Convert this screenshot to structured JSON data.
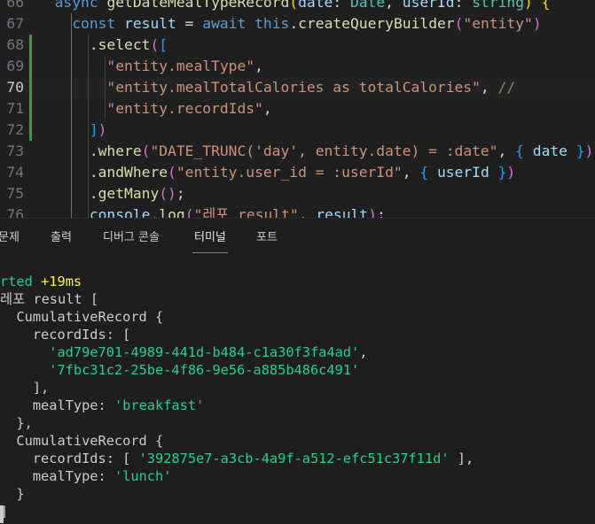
{
  "editor": {
    "lines": [
      {
        "num": "66",
        "tokens": [
          {
            "t": "  ",
            "c": "pn"
          },
          {
            "t": "async ",
            "c": "kw"
          },
          {
            "t": "getDateMealTypeRecord",
            "c": "fn"
          },
          {
            "t": "(",
            "c": "br1"
          },
          {
            "t": "date",
            "c": "param"
          },
          {
            "t": ": ",
            "c": "pn"
          },
          {
            "t": "Date",
            "c": "ty"
          },
          {
            "t": ", ",
            "c": "pn"
          },
          {
            "t": "userId",
            "c": "param"
          },
          {
            "t": ": ",
            "c": "pn"
          },
          {
            "t": "string",
            "c": "ty"
          },
          {
            "t": ") ",
            "c": "br1"
          },
          {
            "t": "{",
            "c": "br1"
          }
        ]
      },
      {
        "num": "67",
        "tokens": [
          {
            "t": "    ",
            "c": "pn"
          },
          {
            "t": "const ",
            "c": "kw"
          },
          {
            "t": "result",
            "c": "param"
          },
          {
            "t": " = ",
            "c": "pn"
          },
          {
            "t": "await ",
            "c": "kw"
          },
          {
            "t": "this",
            "c": "kw"
          },
          {
            "t": ".",
            "c": "pn"
          },
          {
            "t": "createQueryBuilder",
            "c": "fn"
          },
          {
            "t": "(",
            "c": "br2"
          },
          {
            "t": "\"entity\"",
            "c": "str"
          },
          {
            "t": ")",
            "c": "br2"
          }
        ]
      },
      {
        "num": "68",
        "tokens": [
          {
            "t": "      .",
            "c": "pn"
          },
          {
            "t": "select",
            "c": "fn"
          },
          {
            "t": "(",
            "c": "br2"
          },
          {
            "t": "[",
            "c": "br3"
          }
        ]
      },
      {
        "num": "69",
        "tokens": [
          {
            "t": "        ",
            "c": "pn"
          },
          {
            "t": "\"entity.mealType\"",
            "c": "str"
          },
          {
            "t": ",",
            "c": "pn"
          }
        ]
      },
      {
        "num": "70",
        "tokens": [
          {
            "t": "        ",
            "c": "pn"
          },
          {
            "t": "\"entity.mealTotalCalories as totalCalories\"",
            "c": "str"
          },
          {
            "t": ", ",
            "c": "pn"
          },
          {
            "t": "//",
            "c": "cm"
          }
        ]
      },
      {
        "num": "71",
        "tokens": [
          {
            "t": "        ",
            "c": "pn"
          },
          {
            "t": "\"entity.recordIds\"",
            "c": "str"
          },
          {
            "t": ",",
            "c": "pn"
          }
        ]
      },
      {
        "num": "72",
        "tokens": [
          {
            "t": "      ",
            "c": "pn"
          },
          {
            "t": "]",
            "c": "br3"
          },
          {
            "t": ")",
            "c": "br2"
          }
        ]
      },
      {
        "num": "73",
        "tokens": [
          {
            "t": "      .",
            "c": "pn"
          },
          {
            "t": "where",
            "c": "fn"
          },
          {
            "t": "(",
            "c": "br2"
          },
          {
            "t": "\"DATE_TRUNC('day', entity.date) = :date\"",
            "c": "str"
          },
          {
            "t": ", ",
            "c": "pn"
          },
          {
            "t": "{",
            "c": "br3"
          },
          {
            "t": " date ",
            "c": "param"
          },
          {
            "t": "}",
            "c": "br3"
          },
          {
            "t": ")",
            "c": "br2"
          }
        ]
      },
      {
        "num": "74",
        "tokens": [
          {
            "t": "      .",
            "c": "pn"
          },
          {
            "t": "andWhere",
            "c": "fn"
          },
          {
            "t": "(",
            "c": "br2"
          },
          {
            "t": "\"entity.user_id = :userId\"",
            "c": "str"
          },
          {
            "t": ", ",
            "c": "pn"
          },
          {
            "t": "{",
            "c": "br3"
          },
          {
            "t": " userId ",
            "c": "param"
          },
          {
            "t": "}",
            "c": "br3"
          },
          {
            "t": ")",
            "c": "br2"
          }
        ]
      },
      {
        "num": "75",
        "tokens": [
          {
            "t": "      .",
            "c": "pn"
          },
          {
            "t": "getMany",
            "c": "fn"
          },
          {
            "t": "()",
            "c": "br2"
          },
          {
            "t": ";",
            "c": "pn"
          }
        ]
      },
      {
        "num": "76",
        "tokens": [
          {
            "t": "      ",
            "c": "pn"
          },
          {
            "t": "console",
            "c": "param"
          },
          {
            "t": ".",
            "c": "pn"
          },
          {
            "t": "log",
            "c": "fn"
          },
          {
            "t": "(",
            "c": "br2"
          },
          {
            "t": "\"레포 result\"",
            "c": "str"
          },
          {
            "t": ", ",
            "c": "pn"
          },
          {
            "t": "result",
            "c": "param"
          },
          {
            "t": ")",
            "c": "br2"
          },
          {
            "t": ";",
            "c": "pn"
          }
        ]
      }
    ],
    "current_line": "70"
  },
  "panel": {
    "tabs": [
      "문제",
      "출력",
      "디버그 콘솔",
      "터미널",
      "포트"
    ],
    "active_tab": "터미널"
  },
  "terminal": {
    "lines": [
      [
        {
          "t": "rted ",
          "c": "tgreen"
        },
        {
          "t": "+19ms",
          "c": "tyellow"
        }
      ],
      [
        {
          "t": "레포 result [",
          "c": ""
        }
      ],
      [
        {
          "t": "  CumulativeRecord {",
          "c": ""
        }
      ],
      [
        {
          "t": "    recordIds: [",
          "c": ""
        }
      ],
      [
        {
          "t": "      ",
          "c": ""
        },
        {
          "t": "'ad79e701-4989-441d-b484-c1a30f3fa4ad'",
          "c": "tstr"
        },
        {
          "t": ",",
          "c": ""
        }
      ],
      [
        {
          "t": "      ",
          "c": ""
        },
        {
          "t": "'7fbc31c2-25be-4f86-9e56-a885b486c491'",
          "c": "tstr"
        }
      ],
      [
        {
          "t": "    ],",
          "c": ""
        }
      ],
      [
        {
          "t": "    mealType: ",
          "c": ""
        },
        {
          "t": "'breakfast'",
          "c": "tstr"
        }
      ],
      [
        {
          "t": "  },",
          "c": ""
        }
      ],
      [
        {
          "t": "  CumulativeRecord {",
          "c": ""
        }
      ],
      [
        {
          "t": "    recordIds: [ ",
          "c": ""
        },
        {
          "t": "'392875e7-a3cb-4a9f-a512-efc51c37f11d'",
          "c": "tstr"
        },
        {
          "t": " ],",
          "c": ""
        }
      ],
      [
        {
          "t": "    mealType: ",
          "c": ""
        },
        {
          "t": "'lunch'",
          "c": "tstr"
        }
      ],
      [
        {
          "t": "  }",
          "c": ""
        }
      ],
      [
        {
          "t": "]",
          "c": ""
        }
      ]
    ]
  }
}
